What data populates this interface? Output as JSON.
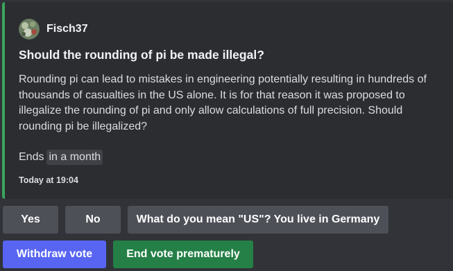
{
  "poll": {
    "author": "Fisch37",
    "title": "Should the rounding of pi be made illegal?",
    "description": "Rounding pi can lead to mistakes in engineering potentially resulting in hundreds of thousands of casualties in the US alone. It is for that reason it was proposed to illegalize the rounding of pi and only allow calculations of full precision. Should rounding pi be illegalized?",
    "ends_label": "Ends",
    "ends_time": "in a month",
    "timestamp": "Today at 19:04"
  },
  "options": [
    "Yes",
    "No",
    "What do you mean \"US\"? You live in Germany"
  ],
  "actions": {
    "withdraw": "Withdraw vote",
    "end": "End vote prematurely"
  },
  "colors": {
    "accent_bar": "#3ba55d",
    "blurple": "#5865f2",
    "green_button": "#248046",
    "grey_button": "#4e5058"
  }
}
